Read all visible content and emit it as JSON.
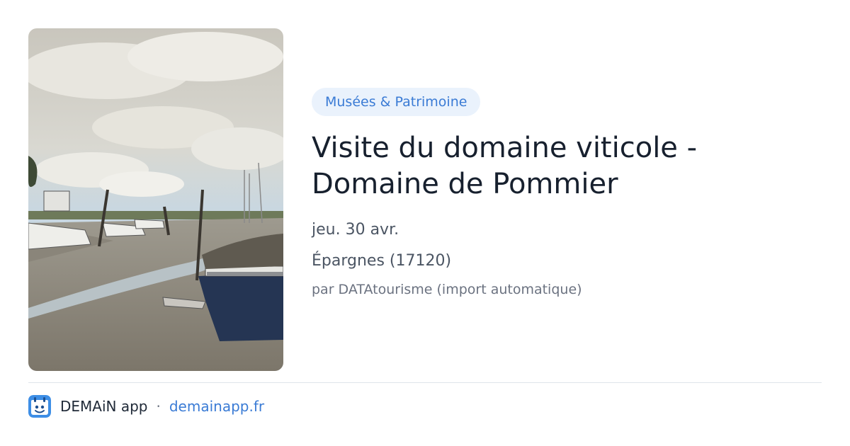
{
  "event": {
    "category": "Musées & Patrimoine",
    "title": "Visite du domaine viticole - Domaine de Pommier",
    "date": "jeu. 30 avr.",
    "location": "Épargnes (17120)",
    "source": "par DATAtourisme (import automatique)"
  },
  "footer": {
    "app_name": "DEMAiN app",
    "separator": "·",
    "domain": "demainapp.fr",
    "app_icon": "demain-app-icon"
  },
  "colors": {
    "accent": "#3a7bd5",
    "chip_background": "#eaf2fc",
    "title": "#17202e",
    "divider": "#dfe5ea"
  }
}
